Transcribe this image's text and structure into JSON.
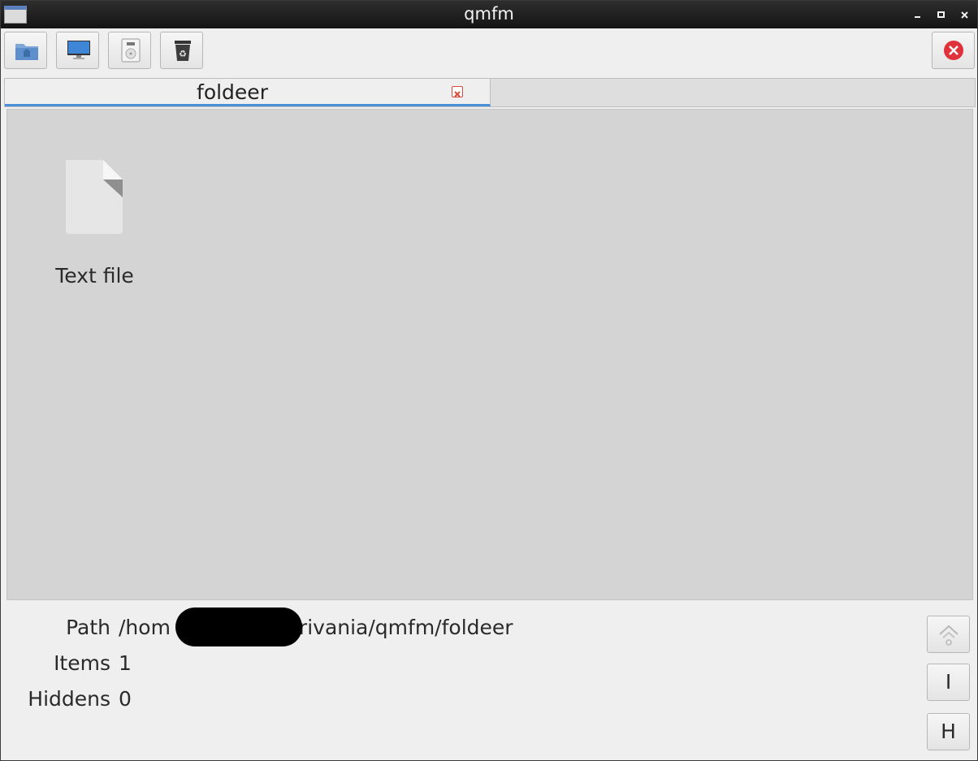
{
  "window": {
    "title": "qmfm"
  },
  "toolbar": {
    "buttons": [
      {
        "icon": "home-folder-icon"
      },
      {
        "icon": "computer-icon"
      },
      {
        "icon": "drive-icon"
      },
      {
        "icon": "trash-icon"
      }
    ],
    "quit_icon": "close-circle-icon"
  },
  "tabs": [
    {
      "label": "foldeer"
    }
  ],
  "files": [
    {
      "label": "Text file",
      "icon": "text-file-icon"
    }
  ],
  "status": {
    "path_label": "Path",
    "path_value_start": "/hom",
    "path_value_end": "rivania/qmfm/foldeer",
    "items_label": "Items",
    "items_value": "1",
    "hiddens_label": "Hiddens",
    "hiddens_value": "0"
  },
  "side_buttons": {
    "info_label": "I",
    "hidden_label": "H",
    "up_icon": "go-up-icon"
  }
}
